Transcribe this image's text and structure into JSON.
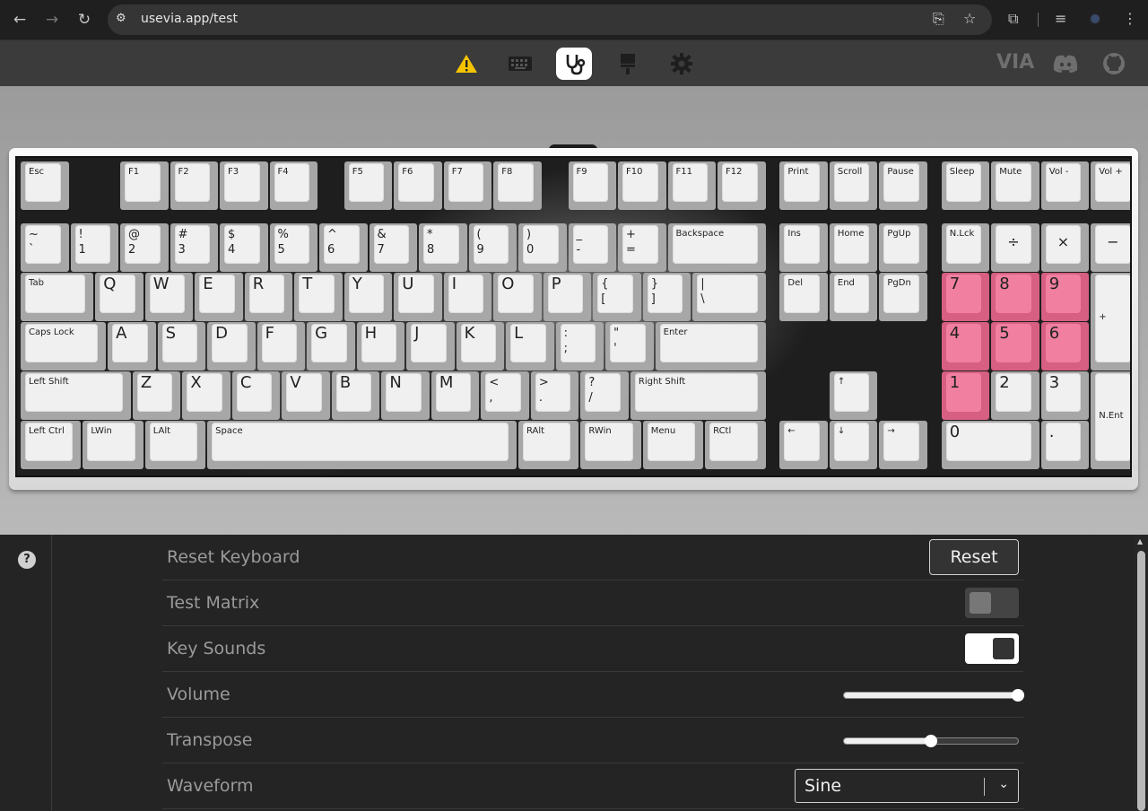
{
  "browser": {
    "url": "usevia.app/test",
    "icons": [
      "back-icon",
      "forward-icon",
      "reload-icon",
      "site-info-icon",
      "install-icon",
      "bookmark-star-icon",
      "extensions-icon",
      "media-icon",
      "profile-avatar",
      "kebab-menu-icon"
    ]
  },
  "topbar": {
    "icons": [
      "warning-icon",
      "keyboard-icon",
      "stethoscope-icon",
      "brush-icon",
      "gear-icon"
    ],
    "active": "stethoscope-icon",
    "right_icons": [
      "via-logo",
      "discord-icon",
      "github-icon"
    ],
    "via_text": "VIA"
  },
  "keyboard": {
    "pressed_color": "#f07fa0",
    "keys": [
      {
        "l": "Esc",
        "s": "small"
      },
      {
        "l": "F1",
        "s": "small"
      },
      {
        "l": "F2",
        "s": "small"
      },
      {
        "l": "F3",
        "s": "small"
      },
      {
        "l": "F4",
        "s": "small"
      },
      {
        "l": "F5",
        "s": "small"
      },
      {
        "l": "F6",
        "s": "small"
      },
      {
        "l": "F7",
        "s": "small"
      },
      {
        "l": "F8",
        "s": "small"
      },
      {
        "l": "F9",
        "s": "small"
      },
      {
        "l": "F10",
        "s": "small"
      },
      {
        "l": "F11",
        "s": "small"
      },
      {
        "l": "F12",
        "s": "small"
      },
      {
        "l": "Print",
        "s": "small"
      },
      {
        "l": "Scroll",
        "s": "small"
      },
      {
        "l": "Pause",
        "s": "small"
      },
      {
        "l": "Sleep",
        "s": "small"
      },
      {
        "l": "Mute",
        "s": "small"
      },
      {
        "l": "Vol -",
        "s": "small"
      },
      {
        "l": "Vol +",
        "s": "small"
      },
      {
        "t": "~",
        "b": "`"
      },
      {
        "t": "!",
        "b": "1"
      },
      {
        "t": "@",
        "b": "2"
      },
      {
        "t": "#",
        "b": "3"
      },
      {
        "t": "$",
        "b": "4"
      },
      {
        "t": "%",
        "b": "5"
      },
      {
        "t": "^",
        "b": "6"
      },
      {
        "t": "&",
        "b": "7"
      },
      {
        "t": "*",
        "b": "8"
      },
      {
        "t": "(",
        "b": "9"
      },
      {
        "t": ")",
        "b": "0"
      },
      {
        "t": "_",
        "b": "-"
      },
      {
        "t": "+",
        "b": "="
      },
      {
        "l": "Backspace",
        "s": "small"
      },
      {
        "l": "Ins",
        "s": "small"
      },
      {
        "l": "Home",
        "s": "small"
      },
      {
        "l": "PgUp",
        "s": "small"
      },
      {
        "l": "N.Lck",
        "s": "small"
      },
      {
        "l": "÷",
        "s": "c"
      },
      {
        "l": "×",
        "s": "c"
      },
      {
        "l": "−",
        "s": "c"
      },
      {
        "l": "Tab",
        "s": "small"
      },
      {
        "l": "Q",
        "s": "big"
      },
      {
        "l": "W",
        "s": "big"
      },
      {
        "l": "E",
        "s": "big"
      },
      {
        "l": "R",
        "s": "big"
      },
      {
        "l": "T",
        "s": "big"
      },
      {
        "l": "Y",
        "s": "big"
      },
      {
        "l": "U",
        "s": "big"
      },
      {
        "l": "I",
        "s": "big"
      },
      {
        "l": "O",
        "s": "big"
      },
      {
        "l": "P",
        "s": "big"
      },
      {
        "t": "{",
        "b": "["
      },
      {
        "t": "}",
        "b": "]"
      },
      {
        "t": "|",
        "b": "\\"
      },
      {
        "l": "Del",
        "s": "small"
      },
      {
        "l": "End",
        "s": "small"
      },
      {
        "l": "PgDn",
        "s": "small"
      },
      {
        "l": "7",
        "s": "big",
        "p": true
      },
      {
        "l": "8",
        "s": "big",
        "p": true
      },
      {
        "l": "9",
        "s": "big",
        "p": true
      },
      {
        "l": "+",
        "s": "small"
      },
      {
        "l": "Caps Lock",
        "s": "small"
      },
      {
        "l": "A",
        "s": "big"
      },
      {
        "l": "S",
        "s": "big"
      },
      {
        "l": "D",
        "s": "big"
      },
      {
        "l": "F",
        "s": "big"
      },
      {
        "l": "G",
        "s": "big"
      },
      {
        "l": "H",
        "s": "big"
      },
      {
        "l": "J",
        "s": "big"
      },
      {
        "l": "K",
        "s": "big"
      },
      {
        "l": "L",
        "s": "big"
      },
      {
        "t": ":",
        "b": ";"
      },
      {
        "t": "\"",
        "b": "'"
      },
      {
        "l": "Enter",
        "s": "small"
      },
      {
        "l": "4",
        "s": "big",
        "p": true
      },
      {
        "l": "5",
        "s": "big",
        "p": true
      },
      {
        "l": "6",
        "s": "big",
        "p": true
      },
      {
        "l": "Left Shift",
        "s": "small"
      },
      {
        "l": "Z",
        "s": "big"
      },
      {
        "l": "X",
        "s": "big"
      },
      {
        "l": "C",
        "s": "big"
      },
      {
        "l": "V",
        "s": "big"
      },
      {
        "l": "B",
        "s": "big"
      },
      {
        "l": "N",
        "s": "big"
      },
      {
        "l": "M",
        "s": "big"
      },
      {
        "t": "<",
        "b": ","
      },
      {
        "t": ">",
        "b": "."
      },
      {
        "t": "?",
        "b": "/"
      },
      {
        "l": "Right Shift",
        "s": "small"
      },
      {
        "l": "↑",
        "s": "small"
      },
      {
        "l": "1",
        "s": "big",
        "p": true
      },
      {
        "l": "2",
        "s": "big"
      },
      {
        "l": "3",
        "s": "big"
      },
      {
        "l": "N.Ent",
        "s": "small"
      },
      {
        "l": "Left Ctrl",
        "s": "small"
      },
      {
        "l": "LWin",
        "s": "small"
      },
      {
        "l": "LAlt",
        "s": "small"
      },
      {
        "l": "Space",
        "s": "small"
      },
      {
        "l": "RAlt",
        "s": "small"
      },
      {
        "l": "RWin",
        "s": "small"
      },
      {
        "l": "Menu",
        "s": "small"
      },
      {
        "l": "RCtl",
        "s": "small"
      },
      {
        "l": "←",
        "s": "small"
      },
      {
        "l": "↓",
        "s": "small"
      },
      {
        "l": "→",
        "s": "small"
      },
      {
        "l": "0",
        "s": "big"
      },
      {
        "l": ".",
        "s": "big"
      }
    ]
  },
  "settings": {
    "help_icon": "?",
    "reset_label": "Reset Keyboard",
    "reset_button": "Reset",
    "test_matrix_label": "Test Matrix",
    "test_matrix_on": false,
    "key_sounds_label": "Key Sounds",
    "key_sounds_on": true,
    "volume_label": "Volume",
    "volume_value": 1.0,
    "transpose_label": "Transpose",
    "transpose_value": 0.5,
    "waveform_label": "Waveform",
    "waveform_value": "Sine"
  }
}
